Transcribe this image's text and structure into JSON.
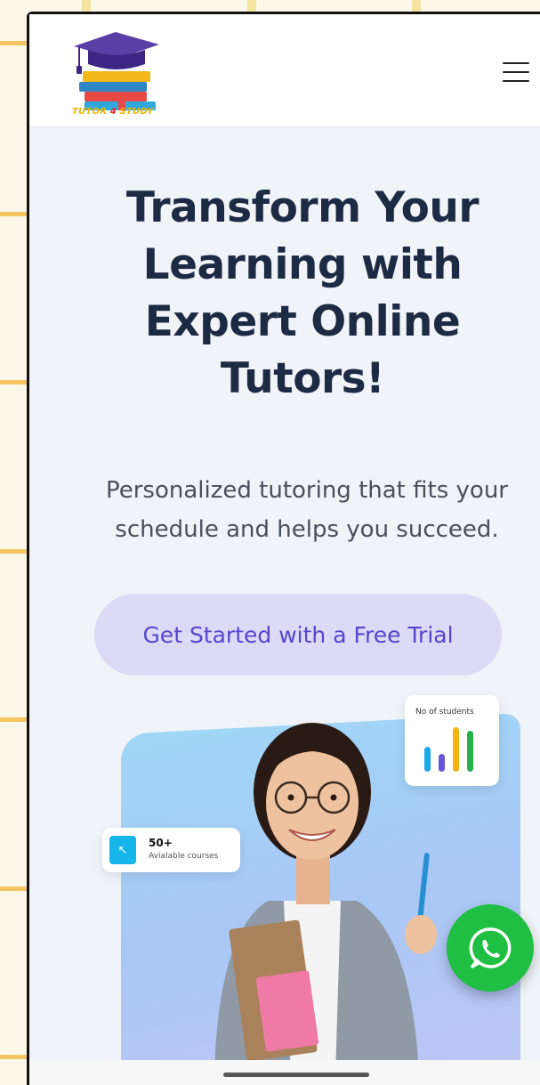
{
  "header": {
    "logo_text_part1": "TUTOR",
    "logo_text_part2": " 4 ",
    "logo_text_part3": "STUDY"
  },
  "hero": {
    "title_line1": "Transform Your",
    "title_line2": "Learning with",
    "title_line3": "Expert Online",
    "title_line4": "Tutors!",
    "subtitle_line1": "Personalized tutoring that fits your",
    "subtitle_line2": "schedule and helps you succeed.",
    "cta_label": "Get Started with a Free Trial"
  },
  "stats": {
    "students_label": "No of students",
    "courses_count": "50+",
    "courses_label": "Avialable courses"
  },
  "icons": [
    "hamburger-menu-icon",
    "arrow-up-left-icon",
    "whatsapp-icon",
    "bar-chart-icon"
  ],
  "colors": {
    "accent": "#5546cc",
    "cta_background": "#dcdaf6",
    "title": "#1d2a44",
    "whatsapp": "#1fbf43",
    "courses_icon": "#16b6ea"
  }
}
